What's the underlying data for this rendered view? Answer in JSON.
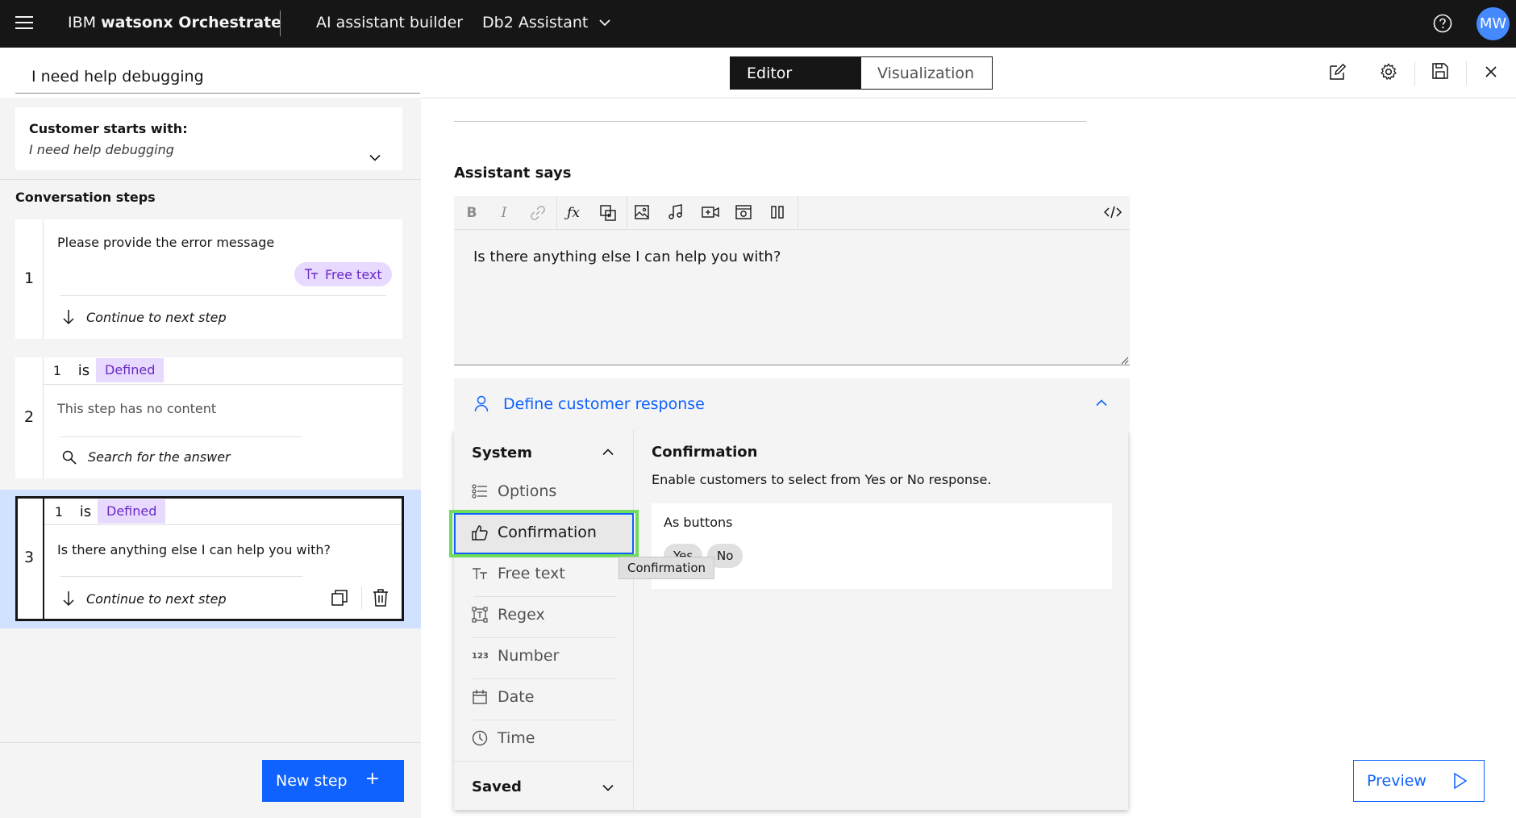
{
  "topbar": {
    "menu_icon": "hamburger-menu-icon",
    "brand_prefix": "IBM ",
    "brand_name": "watsonx Orchestrate",
    "nav_builder": "AI assistant builder",
    "assistant_name": "Db2 Assistant",
    "help_icon": "help-icon",
    "avatar_initials": "MW"
  },
  "action": {
    "title": "I need help debugging",
    "customer_starts_label": "Customer starts with:",
    "customer_starts_value": "I need help debugging",
    "steps_heading": "Conversation steps",
    "steps": [
      {
        "number": "1",
        "text": "Please provide the error message",
        "response_tag": "Free text",
        "next_action": "Continue to next step"
      },
      {
        "number": "2",
        "condition_step": "1",
        "condition_op": "is",
        "condition_value": "Defined",
        "text": "This step has no content",
        "next_action": "Search for the answer"
      },
      {
        "number": "3",
        "condition_step": "1",
        "condition_op": "is",
        "condition_value": "Defined",
        "text": "Is there anything else I can help you with?",
        "next_action": "Continue to next step"
      }
    ],
    "new_step_label": "New step",
    "new_step_plus": "+"
  },
  "view_toggle": {
    "editor": "Editor",
    "visualization": "Visualization",
    "selected": "Editor"
  },
  "editor": {
    "assistant_says_label": "Assistant says",
    "assistant_says_text": "Is there anything else I can help you with?",
    "toolbar_icons": [
      "bold-icon",
      "italic-icon",
      "link-icon",
      "function-icon",
      "variable-icon",
      "image-icon",
      "audio-icon",
      "video-icon",
      "iframe-icon",
      "columns-icon",
      "code-icon"
    ],
    "define_response_label": "Define customer response"
  },
  "response_menu": {
    "system_label": "System",
    "saved_label": "Saved",
    "items": [
      "Options",
      "Confirmation",
      "Free text",
      "Regex",
      "Number",
      "Date",
      "Time"
    ],
    "selected": "Confirmation",
    "tooltip": "Confirmation",
    "detail_title": "Confirmation",
    "detail_desc": "Enable customers to select from Yes or No response.",
    "as_buttons_label": "As buttons",
    "yes_label": "Yes",
    "no_label": "No"
  },
  "preview_label": "Preview",
  "colors": {
    "topbar": "#161616",
    "accent": "#0f62fe",
    "tag_bg": "#e8daff",
    "tag_fg": "#6929c4",
    "highlight": "#6fdc5a"
  }
}
